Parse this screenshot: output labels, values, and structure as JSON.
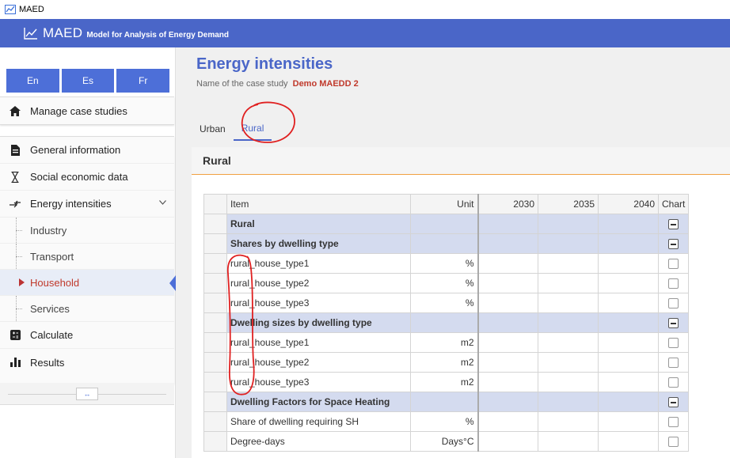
{
  "window": {
    "title": "MAED"
  },
  "header": {
    "logo": "MAED",
    "subtitle": "Model for Analysis of Energy Demand"
  },
  "languages": [
    "En",
    "Es",
    "Fr"
  ],
  "sidebar": {
    "manage": "Manage case studies",
    "general": "General information",
    "social": "Social economic data",
    "intensities": "Energy intensities",
    "sub": [
      "Industry",
      "Transport",
      "Household",
      "Services"
    ],
    "calculate": "Calculate",
    "results": "Results",
    "collapse": "↔"
  },
  "main": {
    "title": "Energy intensities",
    "case_label": "Name of the case study",
    "case_name": "Demo MAEDD 2",
    "tabs": [
      "Urban",
      "Rural"
    ],
    "panel_title": "Rural"
  },
  "table": {
    "headers": {
      "item": "Item",
      "unit": "Unit",
      "y1": "2030",
      "y2": "2035",
      "y3": "2040",
      "chart": "Chart"
    },
    "rows": [
      {
        "item": "Rural",
        "unit": "",
        "group": true
      },
      {
        "item": "Shares by dwelling type",
        "unit": "",
        "group": true
      },
      {
        "item": "rural_house_type1",
        "unit": "%",
        "group": false
      },
      {
        "item": "rural_house_type2",
        "unit": "%",
        "group": false
      },
      {
        "item": "rural_house_type3",
        "unit": "%",
        "group": false
      },
      {
        "item": "Dwelling sizes by dwelling type",
        "unit": "",
        "group": true
      },
      {
        "item": "rural_house_type1",
        "unit": "m2",
        "group": false
      },
      {
        "item": "rural_house_type2",
        "unit": "m2",
        "group": false
      },
      {
        "item": "rural_house_type3",
        "unit": "m2",
        "group": false
      },
      {
        "item": "Dwelling Factors for Space Heating",
        "unit": "",
        "group": true
      },
      {
        "item": "Share of dwelling requiring SH",
        "unit": "%",
        "group": false
      },
      {
        "item": "Degree-days",
        "unit": "Days°C",
        "group": false
      }
    ]
  },
  "colors": {
    "accent": "#4a66c8",
    "case_name": "#c0392b",
    "annotation": "#e02020"
  }
}
